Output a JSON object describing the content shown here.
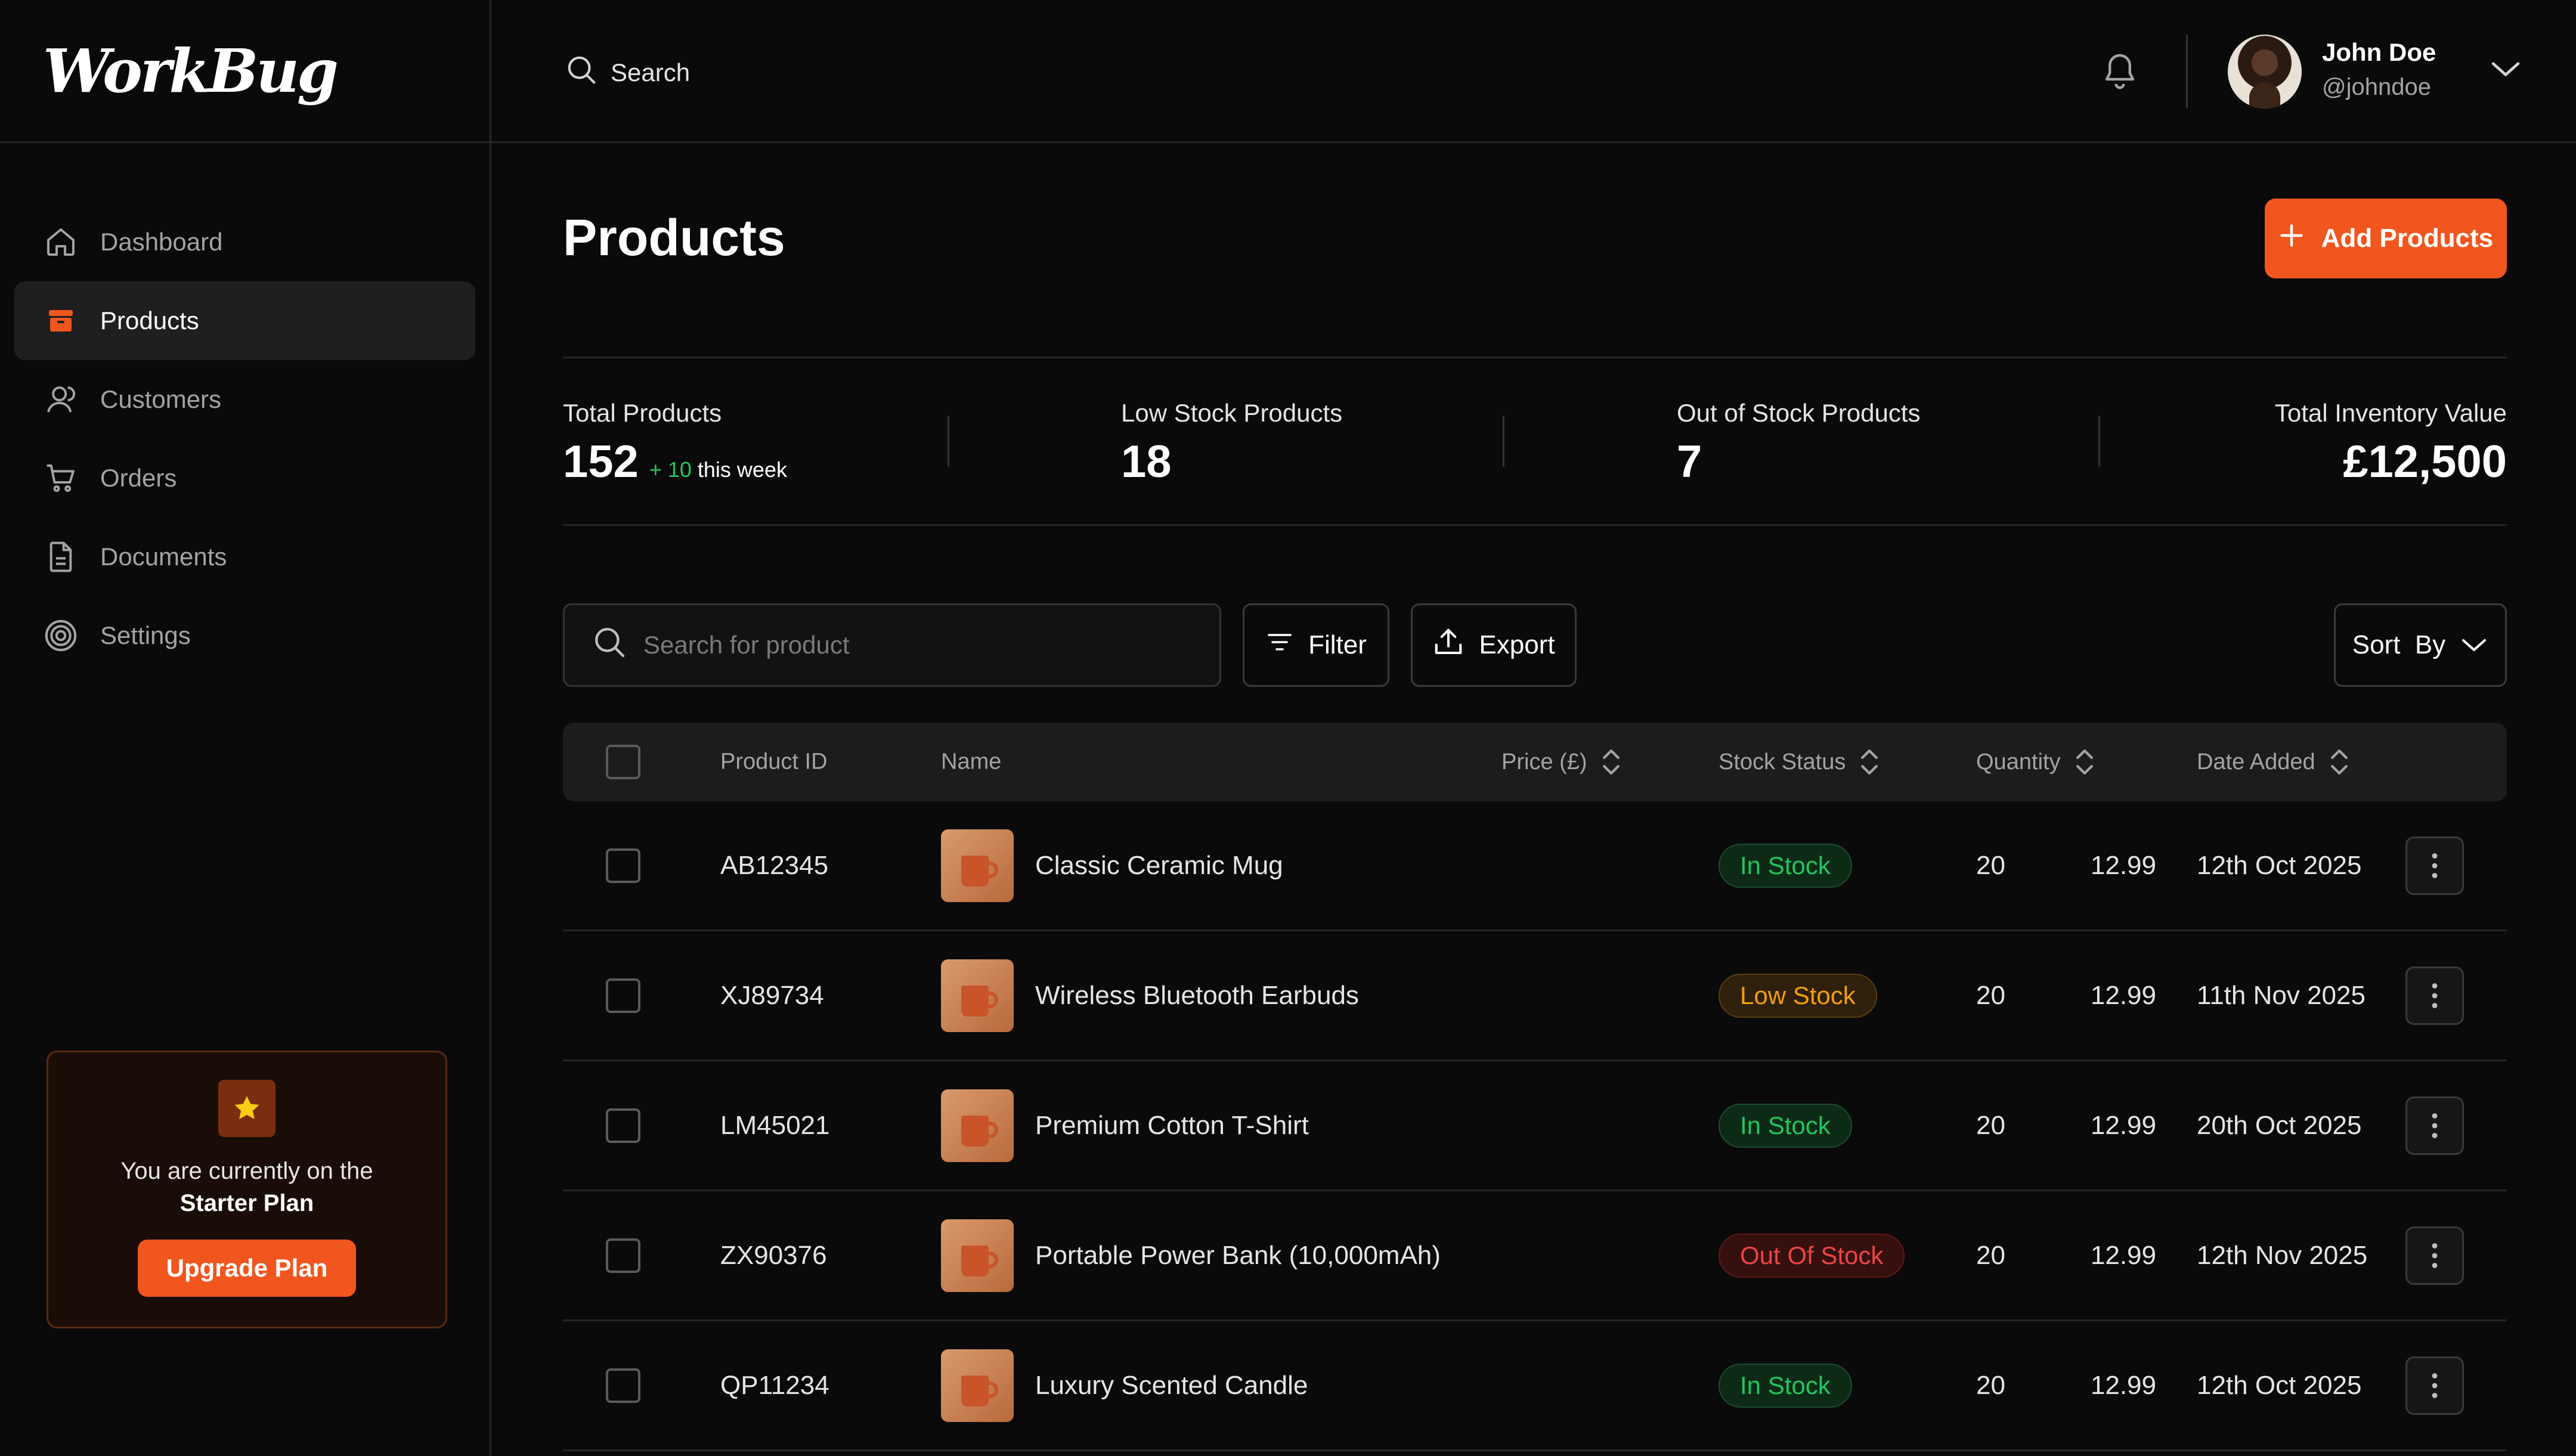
{
  "brand": {
    "name": "WorkBug"
  },
  "sidebar": {
    "items": [
      {
        "label": "Dashboard",
        "icon": "home-icon"
      },
      {
        "label": "Products",
        "icon": "products-icon",
        "active": true
      },
      {
        "label": "Customers",
        "icon": "users-icon"
      },
      {
        "label": "Orders",
        "icon": "cart-icon"
      },
      {
        "label": "Documents",
        "icon": "document-icon"
      },
      {
        "label": "Settings",
        "icon": "gear-icon"
      }
    ],
    "plan": {
      "text": "You are currently on the",
      "name": "Starter Plan",
      "button": "Upgrade Plan"
    }
  },
  "topbar": {
    "search_label": "Search",
    "user": {
      "name": "John Doe",
      "handle": "@johndoe"
    }
  },
  "page": {
    "title": "Products",
    "add_button": "Add Products"
  },
  "stats": [
    {
      "label": "Total Products",
      "value": "152",
      "delta": "+ 10",
      "delta_suffix": "this week"
    },
    {
      "label": "Low Stock Products",
      "value": "18"
    },
    {
      "label": "Out of Stock Products",
      "value": "7"
    },
    {
      "label": "Total Inventory Value",
      "value": "£12,500"
    }
  ],
  "toolbar": {
    "search_placeholder": "Search for product",
    "filter": "Filter",
    "export": "Export",
    "sort": "Sort  By"
  },
  "table": {
    "headers": {
      "id": "Product ID",
      "name": "Name",
      "price": "Price (£)",
      "status": "Stock Status",
      "qty": "Quantity",
      "date": "Date Added"
    },
    "rows": [
      {
        "id": "AB12345",
        "name": "Classic Ceramic Mug",
        "price": "12.99",
        "status": "In Stock",
        "status_kind": "instock",
        "qty": "20",
        "date": "12th Oct 2025"
      },
      {
        "id": "XJ89734",
        "name": "Wireless Bluetooth Earbuds",
        "price": "12.99",
        "status": "Low Stock",
        "status_kind": "low",
        "qty": "20",
        "date": "11th Nov 2025"
      },
      {
        "id": "LM45021",
        "name": "Premium Cotton T-Shirt",
        "price": "12.99",
        "status": "In Stock",
        "status_kind": "instock",
        "qty": "20",
        "date": "20th Oct 2025"
      },
      {
        "id": "ZX90376",
        "name": "Portable Power Bank (10,000mAh)",
        "price": "12.99",
        "status": "Out Of Stock",
        "status_kind": "out",
        "qty": "20",
        "date": "12th Nov 2025"
      },
      {
        "id": "QP11234",
        "name": "Luxury Scented Candle",
        "price": "12.99",
        "status": "In Stock",
        "status_kind": "instock",
        "qty": "20",
        "date": "12th Oct 2025"
      }
    ]
  },
  "colors": {
    "accent": "#f0561d",
    "in_stock": "#22c55e",
    "low_stock": "#f59e0b",
    "out_of_stock": "#ef4444"
  }
}
